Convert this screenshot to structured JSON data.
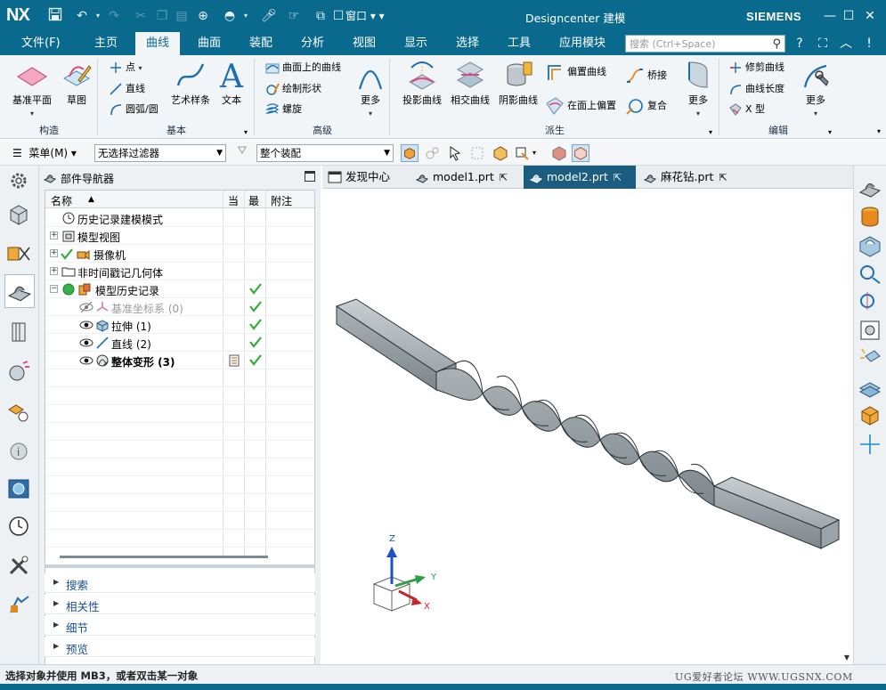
{
  "titlebar": {
    "logo": "NX",
    "window_menu": "窗口",
    "title": "Designcenter 建模",
    "brand": "SIEMENS"
  },
  "menubar": {
    "file": "文件(F)",
    "tabs": [
      "主页",
      "曲线",
      "曲面",
      "装配",
      "分析",
      "视图",
      "显示",
      "选择",
      "工具",
      "应用模块"
    ],
    "active_tab": "曲线",
    "search_placeholder": "搜索 (Ctrl+Space)"
  },
  "ribbon": {
    "groups": {
      "construct": {
        "title": "构造",
        "datum_plane": "基准平面",
        "sketch": "草图"
      },
      "basic": {
        "title": "基本",
        "point": "点",
        "line": "直线",
        "arc": "圆弧/圆",
        "art_spline": "艺术样条",
        "text": "文本"
      },
      "advanced": {
        "title": "高级",
        "curve_on_surface": "曲面上的曲线",
        "draw_shape": "绘制形状",
        "helix": "螺旋",
        "more": "更多"
      },
      "derived": {
        "title": "派生",
        "project_curve": "投影曲线",
        "intersect_curve": "相交曲线",
        "shadow_curve": "阴影曲线",
        "offset_curve": "偏置曲线",
        "offset_on_face": "在面上偏置",
        "bridge": "桥接",
        "composite": "复合",
        "more": "更多"
      },
      "edit": {
        "title": "编辑",
        "trim_curve": "修剪曲线",
        "curve_length": "曲线长度",
        "x_form": "X 型",
        "more": "更多"
      }
    }
  },
  "toolbar2": {
    "menu": "菜单(M)",
    "filter": "无选择过滤器",
    "scope": "整个装配"
  },
  "navigator": {
    "title": "部件导航器",
    "columns": [
      "名称",
      "当",
      "最",
      "附注"
    ],
    "rows": [
      {
        "label": "历史记录建模模式"
      },
      {
        "label": "模型视图"
      },
      {
        "label": "摄像机"
      },
      {
        "label": "非时间戳记几何体"
      },
      {
        "label": "模型历史记录"
      },
      {
        "label": "基准坐标系 (0)"
      },
      {
        "label": "拉伸 (1)"
      },
      {
        "label": "直线 (2)"
      },
      {
        "label": "整体变形 (3)"
      }
    ],
    "sections": [
      "搜索",
      "相关性",
      "细节",
      "预览"
    ]
  },
  "doctabs": [
    {
      "label": "发现中心"
    },
    {
      "label": "model1.prt"
    },
    {
      "label": "model2.prt"
    },
    {
      "label": "麻花钻.prt"
    }
  ],
  "triad": {
    "z": "Z",
    "y": "Y",
    "x": "X"
  },
  "status": {
    "message": "选择对象并使用 MB3，或者双击某一对象",
    "watermark": "UG爱好者论坛 WWW.UGSNX.COM"
  },
  "colors": {
    "brand": "#0a6a8e",
    "active_tab": "#1c5c7f",
    "check": "#2fae39",
    "model": "#a9b1b5"
  }
}
